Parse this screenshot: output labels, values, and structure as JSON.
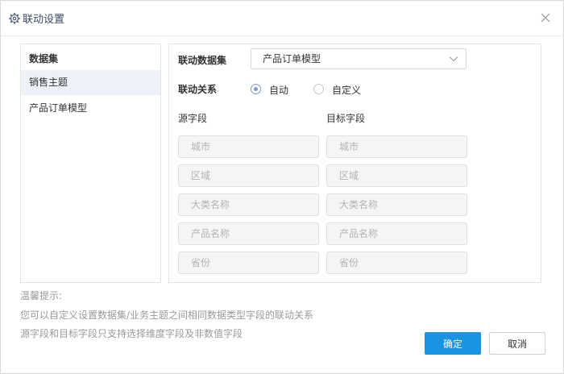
{
  "dialog": {
    "title": "联动设置",
    "icons": {
      "title": "gear-icon",
      "close": "close-icon"
    }
  },
  "datasets": {
    "header": "数据集",
    "items": [
      {
        "label": "销售主题",
        "selected": true
      },
      {
        "label": "产品订单模型",
        "selected": false
      }
    ]
  },
  "linkage": {
    "dataset_label": "联动数据集",
    "dataset_value": "产品订单模型",
    "relation_label": "联动关系",
    "relation_options": [
      {
        "label": "自动",
        "checked": true
      },
      {
        "label": "自定义",
        "checked": false
      }
    ],
    "source_label": "源字段",
    "target_label": "目标字段",
    "source_fields": [
      "城市",
      "区域",
      "大类名称",
      "产品名称",
      "省份"
    ],
    "target_fields": [
      "城市",
      "区域",
      "大类名称",
      "产品名称",
      "省份"
    ]
  },
  "tips": {
    "title": "温馨提示:",
    "line1": "您可以自定义设置数据集/业务主题之间相同数据类型字段的联动关系",
    "line2": "源字段和目标字段只支持选择维度字段及非数值字段"
  },
  "buttons": {
    "ok": "确定",
    "cancel": "取消"
  },
  "colors": {
    "primary": "#1a93e0",
    "radio": "#7a9ccf",
    "selected_row": "#eef2f8"
  }
}
